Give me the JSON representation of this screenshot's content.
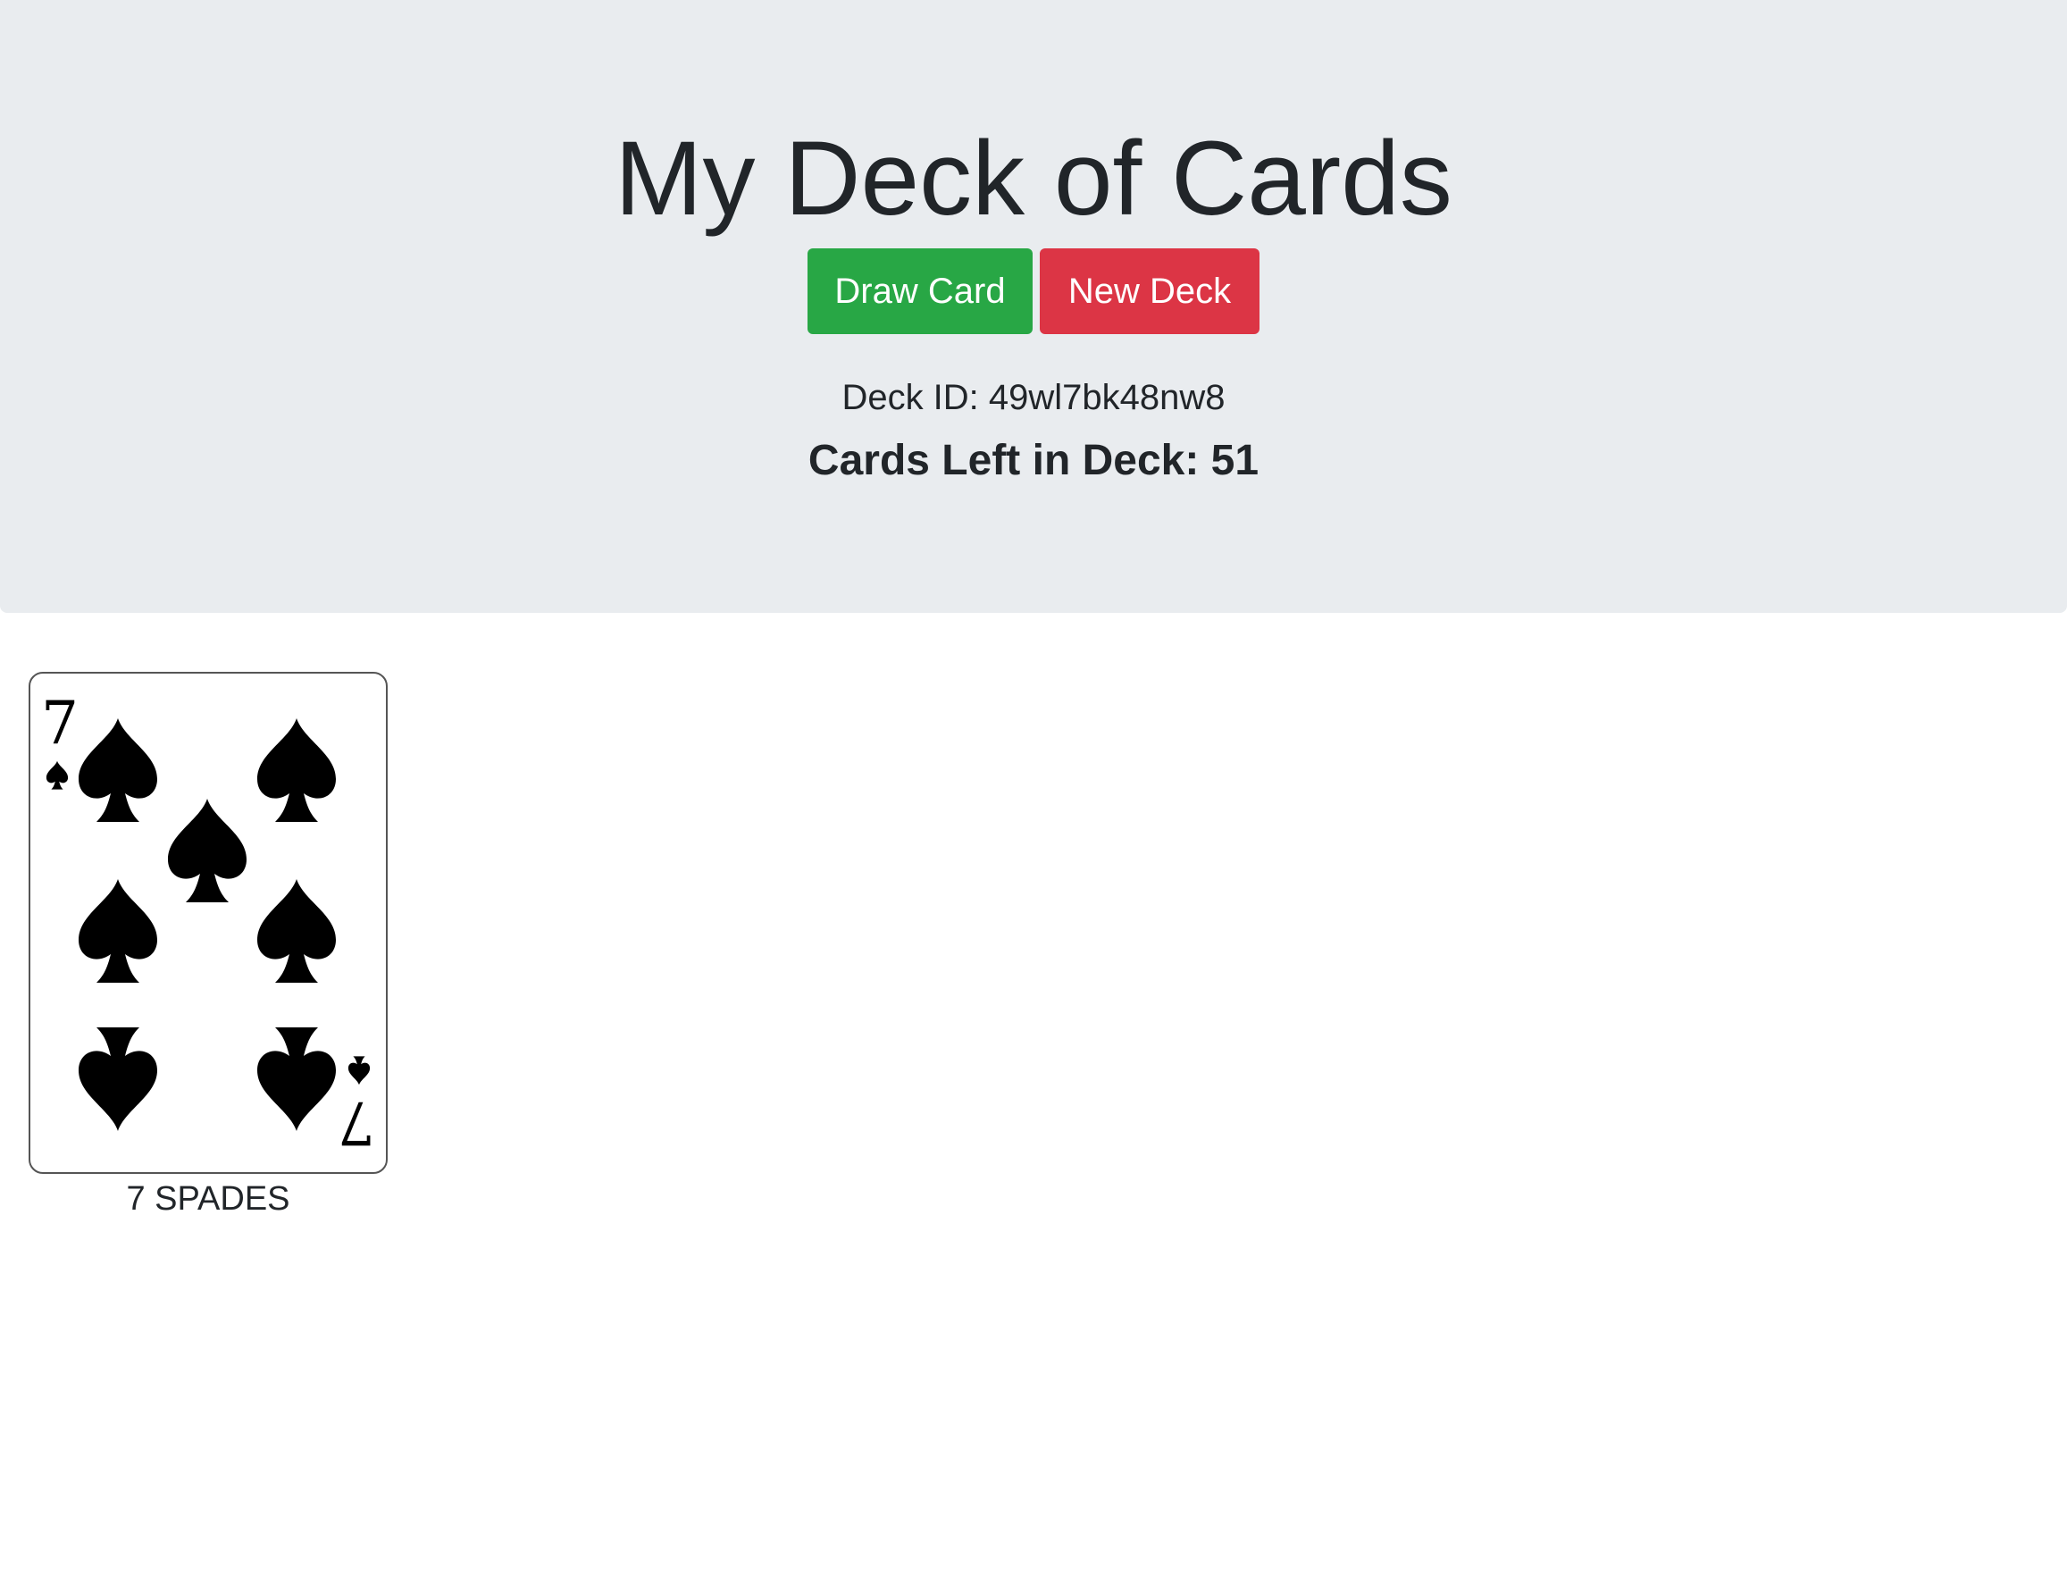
{
  "header": {
    "title": "My Deck of Cards",
    "draw_button_label": "Draw Card",
    "new_deck_button_label": "New Deck",
    "deck_id_text": "Deck ID: 49wl7bk48nw8",
    "cards_left_text": "Cards Left in Deck: 51"
  },
  "drawn_cards": [
    {
      "rank": "7",
      "suit_icon": "spade-icon",
      "label": "7 SPADES"
    }
  ],
  "colors": {
    "jumbotron_bg": "#e9ecef",
    "draw_button": "#28a745",
    "new_deck_button": "#dc3545"
  }
}
